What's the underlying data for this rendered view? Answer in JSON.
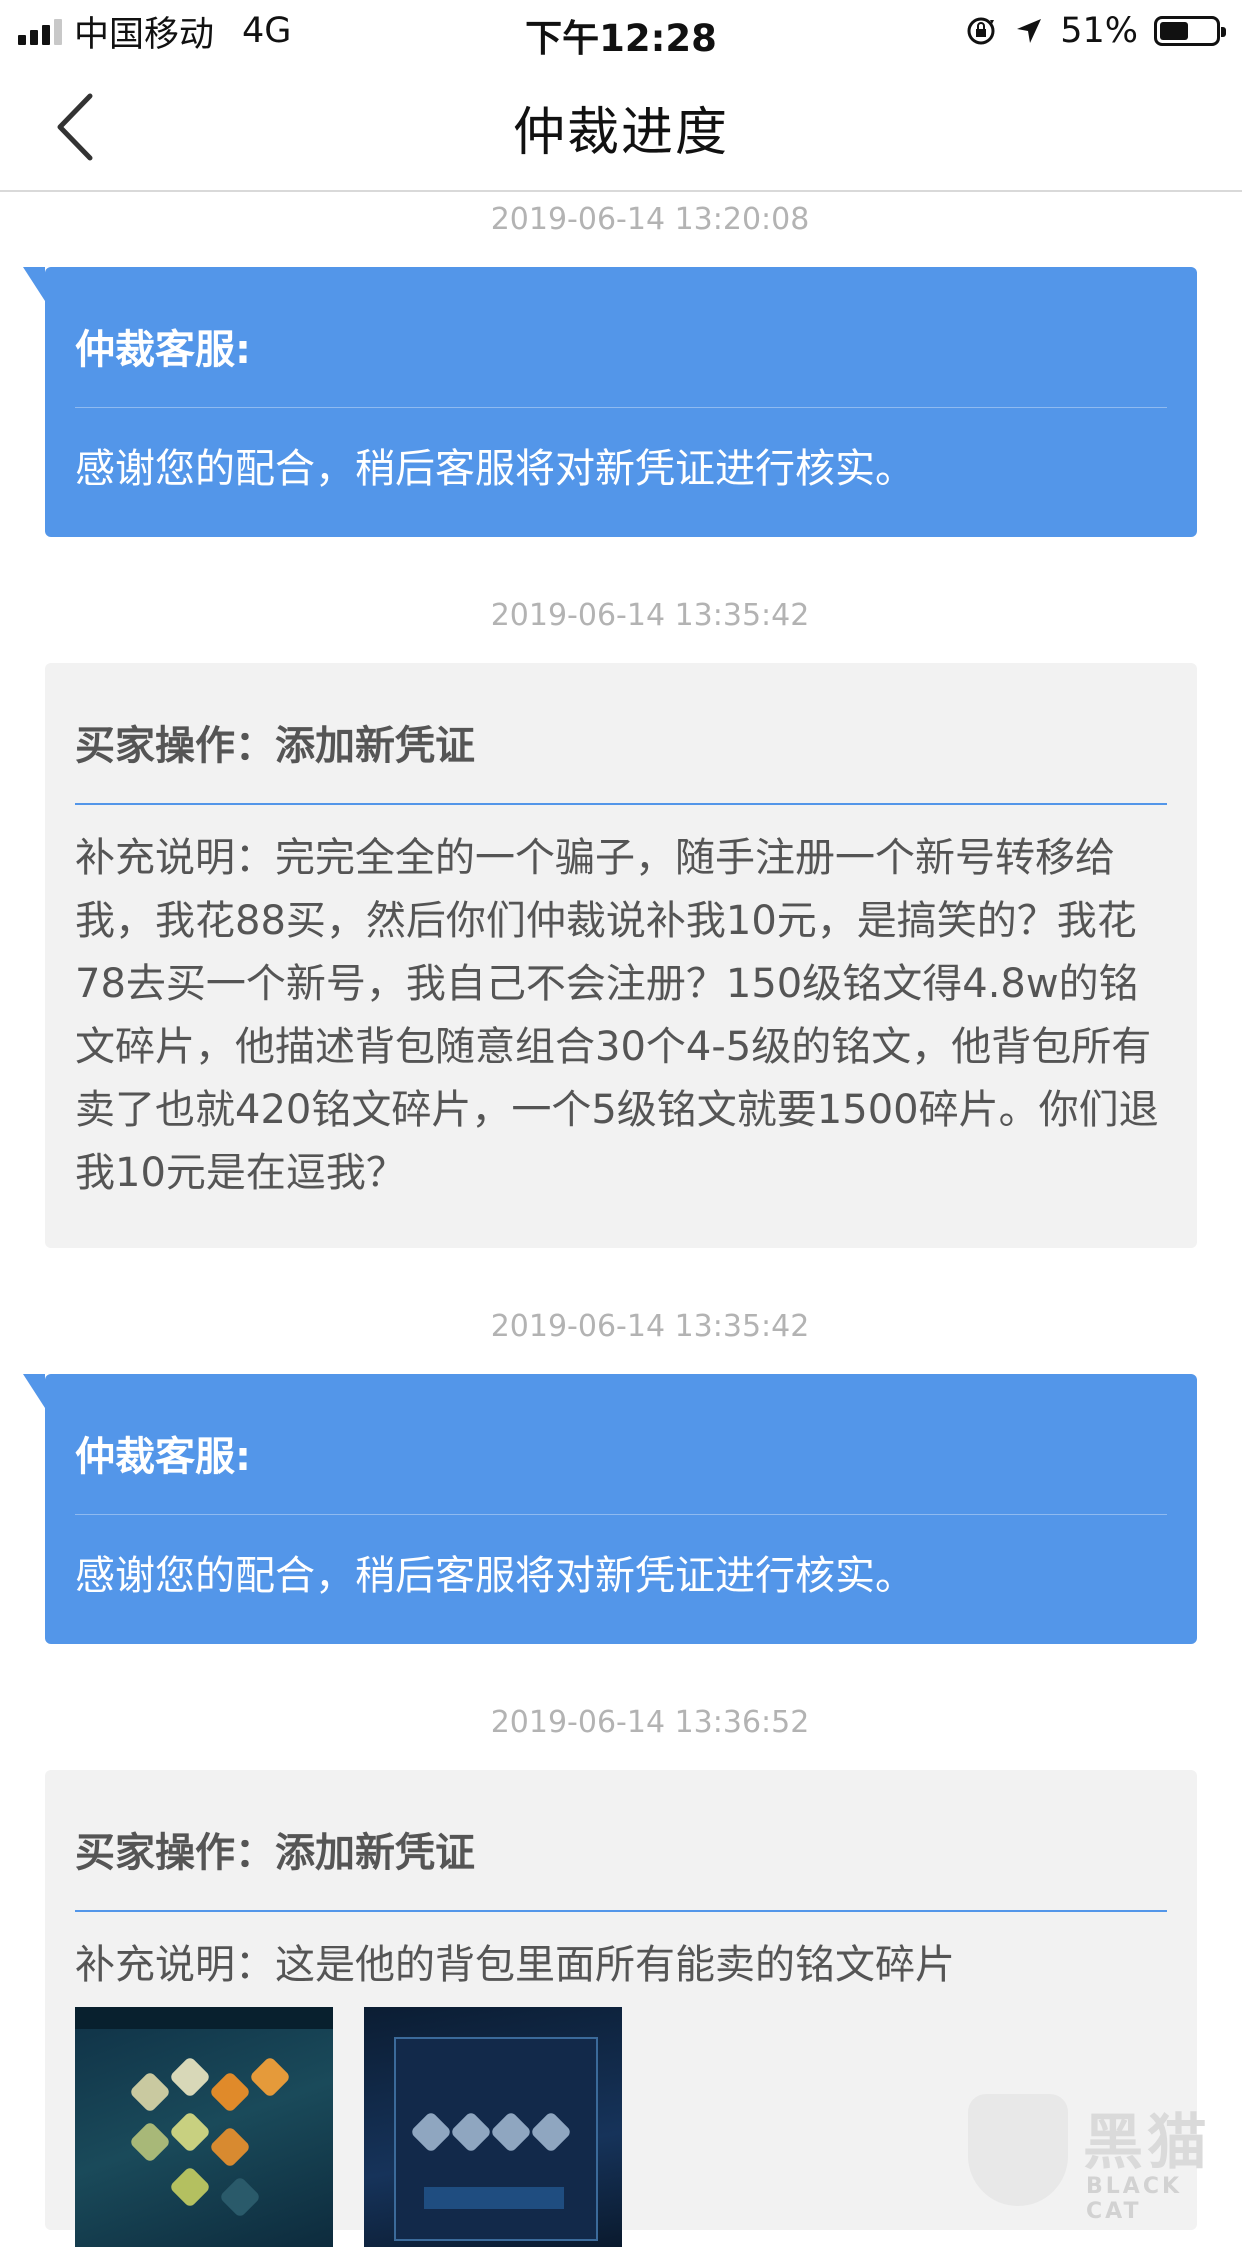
{
  "status_bar": {
    "carrier": "中国移动",
    "network": "4G",
    "time": "下午12:28",
    "battery": "51%",
    "battery_level": 0.51,
    "signal_bars": 3,
    "icons": [
      "signal-bars-icon",
      "rotation-lock-icon",
      "location-arrow-icon",
      "battery-icon"
    ]
  },
  "header": {
    "title": "仲裁进度",
    "back_icon": "chevron-left-icon"
  },
  "timeline": [
    {
      "timestamp": "2019-06-14 13:20:08",
      "type": "service",
      "title": "仲裁客服:",
      "body": "感谢您的配合，稍后客服将对新凭证进行核实。"
    },
    {
      "timestamp": "2019-06-14 13:35:42",
      "type": "buyer",
      "title": "买家操作：添加新凭证",
      "body": "补充说明：完完全全的一个骗子，随手注册一个新号转移给我，我花88买，然后你们仲裁说补我10元，是搞笑的？我花78去买一个新号，我自己不会注册？150级铭文得4.8w的铭文碎片，他描述背包随意组合30个4-5级的铭文，他背包所有卖了也就420铭文碎片，一个5级铭文就要1500碎片。你们退我10元是在逗我？"
    },
    {
      "timestamp": "2019-06-14 13:35:42",
      "type": "service",
      "title": "仲裁客服:",
      "body": "感谢您的配合，稍后客服将对新凭证进行核实。"
    },
    {
      "timestamp": "2019-06-14 13:36:52",
      "type": "buyer",
      "title": "买家操作：添加新凭证",
      "body": "补充说明：这是他的背包里面所有能卖的铭文碎片",
      "attachments": [
        "screenshot-thumbnail-1",
        "screenshot-thumbnail-2"
      ]
    }
  ],
  "watermark": {
    "name": "黑猫",
    "sub": "BLACK CAT"
  },
  "colors": {
    "service_card": "#5396e9",
    "buyer_card": "#f2f2f2",
    "timestamp": "#b3b3b3"
  }
}
